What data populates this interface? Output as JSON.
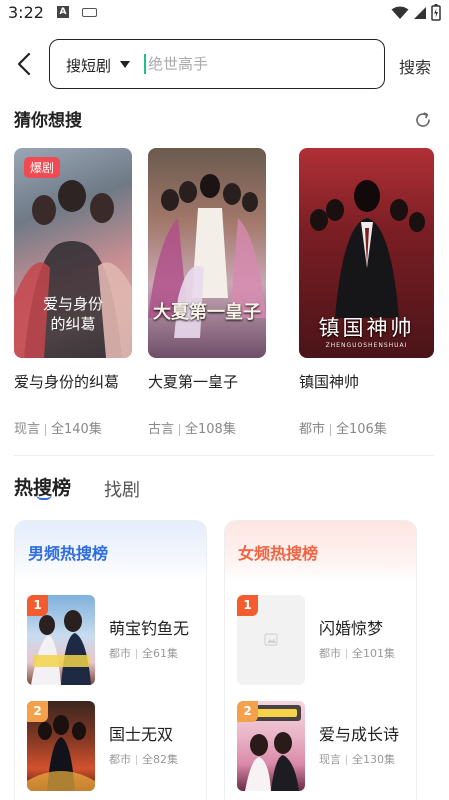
{
  "status": {
    "time": "3:22"
  },
  "search": {
    "back_icon": "chevron-left-icon",
    "category_label": "搜短剧",
    "placeholder": "绝世高手",
    "submit_label": "搜索"
  },
  "guess": {
    "title": "猜你想搜",
    "refresh_icon": "refresh-icon",
    "items": [
      {
        "badge": "爆剧",
        "poster_text": "爱与身份的纠葛",
        "title": "爱与身份的纠葛",
        "genre": "现言",
        "episodes": "全140集"
      },
      {
        "badge": "",
        "poster_text": "大夏第一皇子",
        "title": "大夏第一皇子",
        "genre": "古言",
        "episodes": "全108集"
      },
      {
        "badge": "",
        "poster_text": "镇国神帅",
        "poster_subtext": "ZHENGUOSHENSHUAI",
        "title": "镇国神帅",
        "genre": "都市",
        "episodes": "全106集"
      }
    ]
  },
  "tabs": {
    "hot_label": "热搜榜",
    "find_label": "找剧"
  },
  "rankings": {
    "male": {
      "title": "男频热搜榜",
      "accent": "#2f6de0",
      "items": [
        {
          "rank": "1",
          "name": "萌宝钓鱼无",
          "genre": "都市",
          "episodes": "全61集"
        },
        {
          "rank": "2",
          "name": "国士无双",
          "genre": "都市",
          "episodes": "全82集"
        }
      ]
    },
    "female": {
      "title": "女频热搜榜",
      "accent": "#f26444",
      "items": [
        {
          "rank": "1",
          "name": "闪婚惊梦",
          "genre": "都市",
          "episodes": "全101集"
        },
        {
          "rank": "2",
          "name": "爱与成长诗",
          "genre": "现言",
          "episodes": "全130集"
        }
      ]
    }
  },
  "colors": {
    "rank1": "#f25c2e",
    "rank2": "#f5a04a",
    "badge": "#f04a52"
  }
}
